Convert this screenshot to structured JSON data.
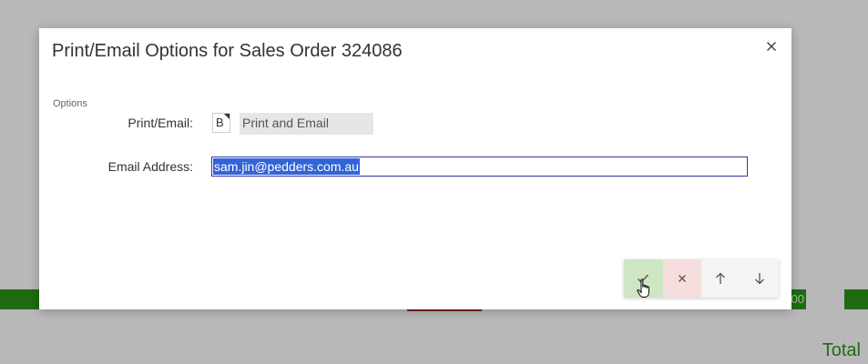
{
  "background": {
    "partial_value": "00",
    "total_label": "Total"
  },
  "dialog": {
    "title": "Print/Email Options for Sales Order 324086",
    "close_icon": "close-icon",
    "section_label": "Options",
    "fields": {
      "print_email": {
        "label": "Print/Email:",
        "code": "B",
        "value": "Print and Email"
      },
      "email_address": {
        "label": "Email Address:",
        "value": "sam.jin@pedders.com.au"
      }
    }
  },
  "toolbar": {
    "ok_icon": "check-icon",
    "cancel_icon": "x-icon",
    "up_icon": "arrow-up-icon",
    "down_icon": "arrow-down-icon"
  },
  "colors": {
    "accent_green": "#1f6b12",
    "selection_blue": "#3264d6",
    "ok_bg": "#cfe6c5",
    "cancel_bg": "#f5dedd"
  }
}
